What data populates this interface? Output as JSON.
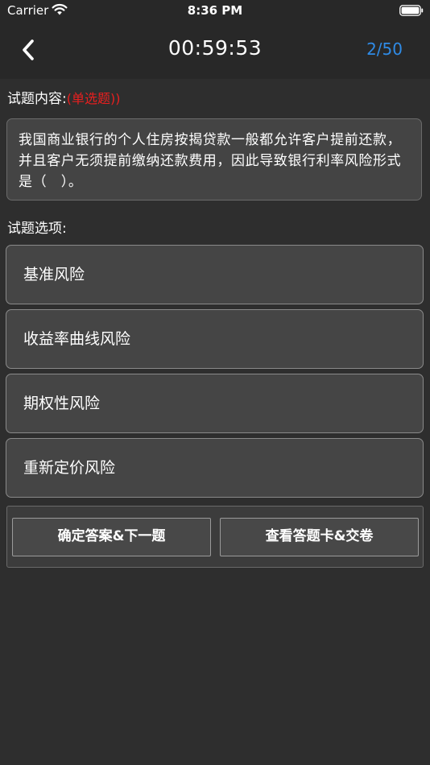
{
  "status_bar": {
    "carrier": "Carrier",
    "time": "8:36 PM"
  },
  "nav": {
    "timer": "00:59:53",
    "progress": "2/50"
  },
  "question": {
    "section_label": "试题内容:",
    "type_label": "(单选题))",
    "text": "我国商业银行的个人住房按揭贷款一般都允许客户提前还款，并且客户无须提前缴纳还款费用，因此导致银行利率风险形式是（　）。"
  },
  "options": {
    "section_label": "试题选项:",
    "items": [
      {
        "label": "基准风险"
      },
      {
        "label": "收益率曲线风险"
      },
      {
        "label": "期权性风险"
      },
      {
        "label": "重新定价风险"
      }
    ]
  },
  "actions": {
    "confirm_label": "确定答案&下一题",
    "answer_card_label": "查看答题卡&交卷"
  },
  "colors": {
    "background": "#2e2e2e",
    "accent": "#2f8be6",
    "question_type": "#e81f1f"
  }
}
